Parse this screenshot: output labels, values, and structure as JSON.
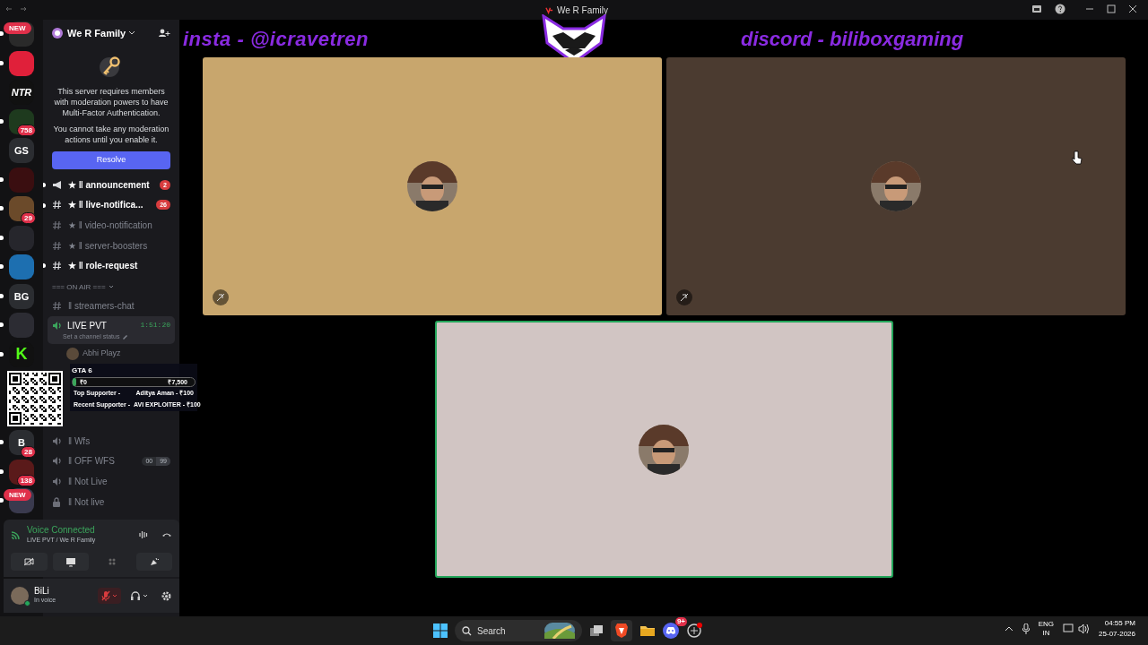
{
  "window": {
    "title": "We R Family"
  },
  "servers": [
    {
      "kind": "new",
      "badge": "NEW",
      "unread": true,
      "color": "#2a2a2a"
    },
    {
      "unread": true,
      "color": "#e0203a"
    },
    {
      "label": "NTR",
      "unread": false,
      "color": "#111111"
    },
    {
      "badge": "758",
      "unread": true,
      "color": "#1e3a1e"
    },
    {
      "label": "GS",
      "unread": false,
      "color": "#2b2d31"
    },
    {
      "unread": true,
      "color": "#3a0e10"
    },
    {
      "badge": "29",
      "unread": true,
      "color": "#6b4a2a"
    },
    {
      "unread": true,
      "color": "#26262c"
    },
    {
      "unread": true,
      "color": "#1d6fb0"
    },
    {
      "label": "BG",
      "unread": true,
      "color": "#2b2d31"
    },
    {
      "unread": true,
      "color": "#2c2c33"
    },
    {
      "label": "K",
      "unread": true,
      "color": "#111111"
    },
    {
      "label": "B",
      "badge": "28",
      "unread": true,
      "color": "#2b2d31"
    },
    {
      "badge": "138",
      "unread": true,
      "color": "#5a1a1a"
    },
    {
      "kind": "new",
      "badge": "NEW",
      "unread": true,
      "color": "#3a3a4e"
    }
  ],
  "server": {
    "name": "We R Family"
  },
  "notice": {
    "text1": "This server requires members with moderation powers to have Multi-Factor Authentication.",
    "text2": "You cannot take any moderation actions until you enable it.",
    "button": "Resolve"
  },
  "channels": [
    {
      "kind": "announcement",
      "name": "★ ‖ announcement",
      "unread": true,
      "mentions": "2"
    },
    {
      "kind": "text",
      "name": "★ ‖ live-notifica...",
      "unread": true,
      "mentions": "26"
    },
    {
      "kind": "text",
      "name": "★ ‖ video-notification",
      "unread": false
    },
    {
      "kind": "text",
      "name": "★ ‖ server-boosters",
      "unread": false
    },
    {
      "kind": "text",
      "name": "★ ‖ role-request",
      "unread": true
    },
    {
      "kind": "category",
      "name": "=== ON AIR ==="
    },
    {
      "kind": "thread",
      "name": "‖ streamers-chat",
      "unread": false
    },
    {
      "kind": "active-voice",
      "name": "LIVE PVT",
      "timer": "1:51:20",
      "status": "Set a channel status",
      "members": [
        {
          "name": "Abhi Playz"
        }
      ]
    },
    {
      "kind": "voice",
      "name": "‖ Wfs",
      "unread": false
    },
    {
      "kind": "voice",
      "name": "‖ OFF WFS",
      "unread": false,
      "limit": [
        "00",
        "99"
      ]
    },
    {
      "kind": "voice",
      "name": "‖ Not Live",
      "unread": false
    },
    {
      "kind": "locked",
      "name": "‖ Not live",
      "unread": false
    }
  ],
  "overlay": {
    "game": "GTA 6",
    "goal_start": "₹0",
    "goal_end": "₹7,500",
    "level": 0,
    "top_label": "Top Supporter -",
    "top_value": "Aditya Aman - ₹100",
    "recent_label": "Recent Supporter -",
    "recent_value": "AVI EXPLOITER - ₹100"
  },
  "voice_status": {
    "title": "Voice Connected",
    "channel": "LIVE PVT / We R Family"
  },
  "user": {
    "name": "BiLi",
    "status": "In voice",
    "muted": true
  },
  "banner": {
    "left": "insta - @icravetren",
    "right": "discord - biliboxgaming"
  },
  "tiles": [
    {
      "color": "#c8a66d",
      "speaking": false
    },
    {
      "color": "#4b3b30",
      "speaking": false
    },
    {
      "color": "#d1c5c3",
      "speaking": true
    }
  ],
  "taskbar": {
    "search": "Search",
    "discord_badge": "9+",
    "lang": "ENG",
    "region": "IN",
    "time": "04:55 PM",
    "date": "25-07-2026"
  }
}
